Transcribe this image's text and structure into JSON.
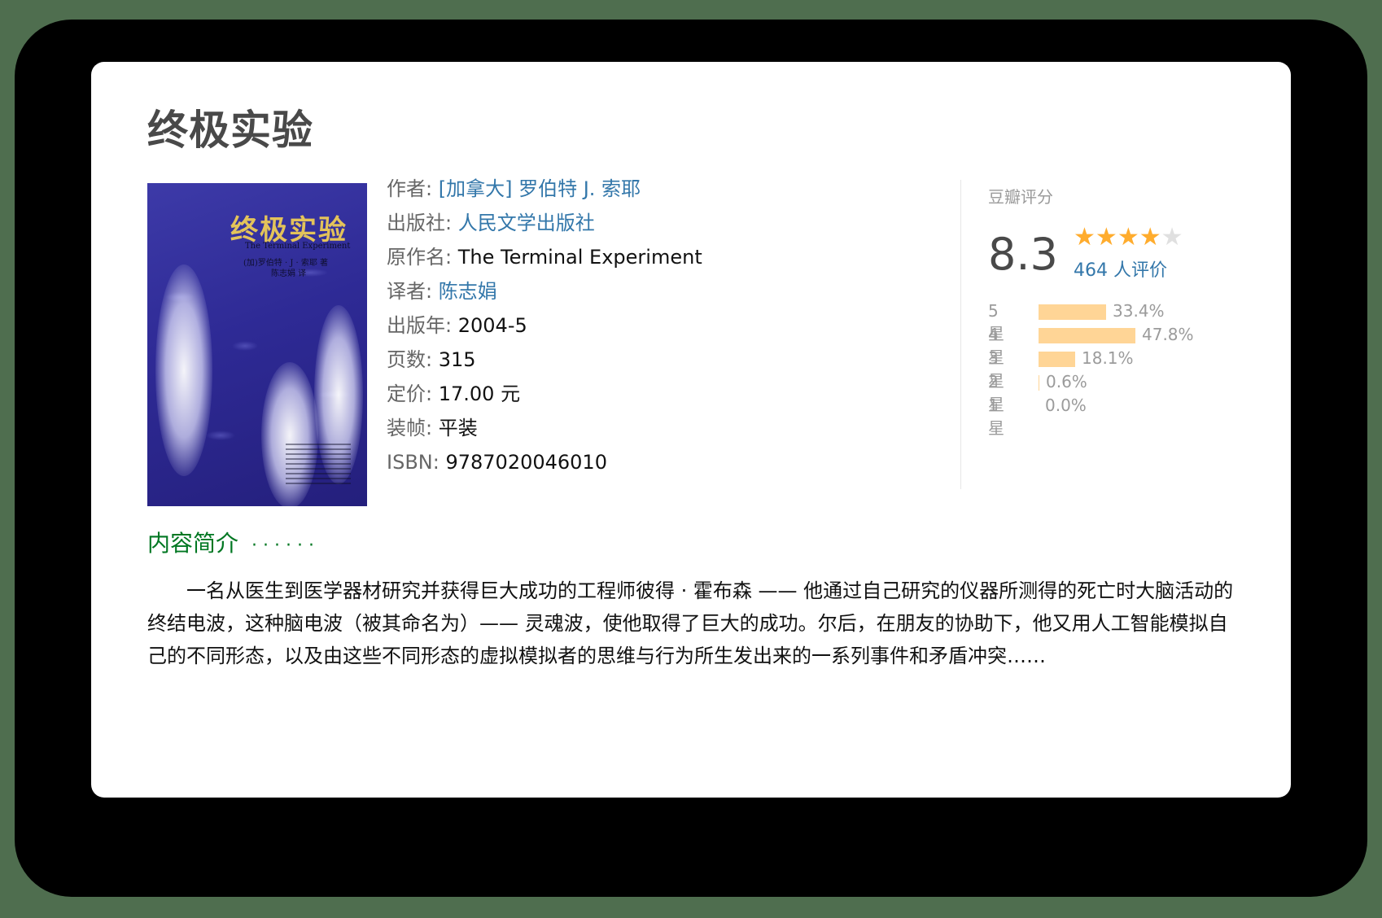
{
  "book": {
    "title": "终极实验",
    "cover": {
      "title": "终极实验",
      "subtitle": "The Terminal Experiment",
      "author_line": "(加)罗伯特 · J · 索耶 著",
      "translator_line": "陈志娟 译"
    },
    "info": [
      {
        "label": "作者:",
        "value": "[加拿大] 罗伯特 J. 索耶",
        "link": true
      },
      {
        "label": "出版社:",
        "value": "人民文学出版社",
        "link": true
      },
      {
        "label": "原作名:",
        "value": "The Terminal Experiment",
        "link": false
      },
      {
        "label": "译者:",
        "value": "陈志娟",
        "link": true
      },
      {
        "label": "出版年:",
        "value": "2004-5",
        "link": false
      },
      {
        "label": "页数:",
        "value": "315",
        "link": false
      },
      {
        "label": "定价:",
        "value": "17.00 元",
        "link": false
      },
      {
        "label": "装帧:",
        "value": "平装",
        "link": false
      },
      {
        "label": "ISBN:",
        "value": "9787020046010",
        "link": false
      }
    ]
  },
  "rating": {
    "label": "豆瓣评分",
    "score": "8.3",
    "stars_filled": 4,
    "stars_total": 5,
    "votes": "464 人评价",
    "distribution": [
      {
        "label": "5 星",
        "percent": 33.4,
        "text": "33.4%"
      },
      {
        "label": "4 星",
        "percent": 47.8,
        "text": "47.8%"
      },
      {
        "label": "3 星",
        "percent": 18.1,
        "text": "18.1%"
      },
      {
        "label": "2 星",
        "percent": 0.6,
        "text": "0.6%"
      },
      {
        "label": "1 星",
        "percent": 0.0,
        "text": "0.0%"
      }
    ]
  },
  "intro": {
    "heading": "内容简介",
    "dots": "······",
    "body": "一名从医生到医学器材研究并获得巨大成功的工程师彼得 · 霍布森 —— 他通过自己研究的仪器所测得的死亡时大脑活动的终结电波，这种脑电波（被其命名为）—— 灵魂波，使他取得了巨大的成功。尔后，在朋友的协助下，他又用人工智能模拟自己的不同形态，以及由这些不同形态的虚拟模拟者的思维与行为所生发出来的一系列事件和矛盾冲突……"
  },
  "colors": {
    "link": "#3377aa",
    "intro_heading": "#007722",
    "star": "#ffac2d",
    "bar": "#ffd596"
  }
}
